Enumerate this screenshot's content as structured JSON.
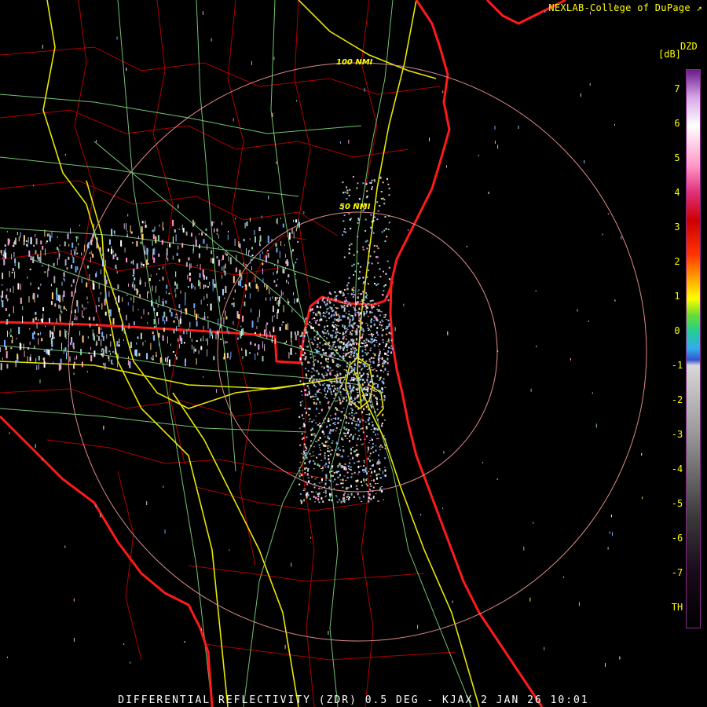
{
  "header": {
    "credit": "NEXLAB-College of DuPage"
  },
  "footer": {
    "product": "DIFFERENTIAL REFLECTIVITY (ZDR) 0.5 DEG - KJAX 2 JAN 26 10:01"
  },
  "radar": {
    "site": "KJAX",
    "ring_labels": [
      "50 NMI",
      "100 NMI"
    ]
  },
  "legend": {
    "title": "DZD",
    "unit": "[dB]",
    "ticks": [
      "7",
      "6",
      "5",
      "4",
      "3",
      "2",
      "1",
      "0",
      "-1",
      "-2",
      "-3",
      "-4",
      "-5",
      "-6",
      "-7",
      "TH"
    ]
  },
  "colors": {
    "state_border": "#ff1a1a",
    "county_lines": "#b00000",
    "highways": "#e8e800",
    "roads": "#7fd97f",
    "range_rings": "#e08a8a",
    "label_text": "#ffff00"
  }
}
